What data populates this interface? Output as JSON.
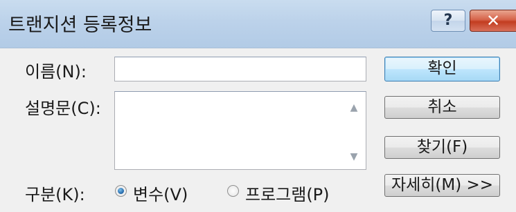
{
  "dialog": {
    "title": "트랜지션 등록정보",
    "help_glyph": "?",
    "close_glyph": "✕"
  },
  "form": {
    "name_label": "이름(N):",
    "name_value": "",
    "description_label": "설명문(C):",
    "description_value": "",
    "category_label": "구분(K):",
    "radio_variable_label": "변수(V)",
    "radio_program_label": "프로그램(P)",
    "selected_category": "변수(V)"
  },
  "buttons": {
    "ok": "확인",
    "cancel": "취소",
    "browse": "찾기(F)",
    "details": "자세히(M) >>"
  },
  "scroll": {
    "up_glyph": "▲",
    "down_glyph": "▼"
  }
}
